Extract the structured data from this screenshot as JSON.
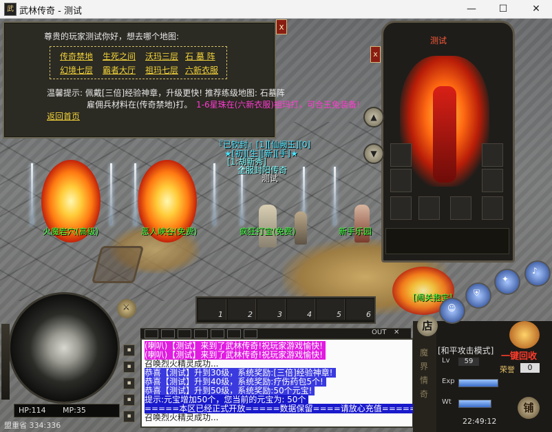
{
  "window": {
    "title": "武林传奇 - 测试",
    "app_icon_text": "武",
    "minimize_glyph": "—",
    "maximize_glyph": "☐",
    "close_glyph": "✕"
  },
  "info_panel": {
    "greeting": "尊贵的玩家测试你好，想去哪个地图:",
    "maps": [
      "传奇禁地",
      "生死之间",
      "沃玛三层",
      "石 墓 阵",
      "幻境七层",
      "霸者大厅",
      "祖玛七层",
      "六新衣服"
    ],
    "tip_line1": "温馨提示: 佩戴[三倍]经验神章，升级更快! 推荐练级地图: 石墓阵",
    "tip_line2": "雇佣兵材料在(传奇禁地)打。",
    "tip_highlight": "1-6星珠在(六新衣服)祖玛打，可合玉兔装备!",
    "back_link": "返回首页",
    "close_glyph": "x"
  },
  "player_overhead": {
    "line1": "『已钦封』[1][仙阙玉][0]",
    "line2": "★[初][生][新][手]★",
    "line3": "[1:胡新秀]",
    "line4": "全服封阳传奇",
    "name": "测试"
  },
  "npcs": [
    {
      "name": "火魔岩穴(高级)",
      "color": "#3dff3d"
    },
    {
      "name": "恶人峡谷(免费)",
      "color": "#3dff3d"
    },
    {
      "name": "疯狂打宝(免费)",
      "color": "#3dff3d"
    },
    {
      "name": "新手乐园",
      "color": "#3dff3d"
    },
    {
      "name": "[闹关抱宝]",
      "color": "#3dff3d"
    }
  ],
  "char_panel": {
    "title": "测试",
    "close_glyph": "x"
  },
  "hotbar": {
    "slots": [
      "1",
      "2",
      "3",
      "4",
      "5",
      "6"
    ]
  },
  "hud": {
    "hp": "HP:114",
    "mp": "MP:35",
    "location": "盟重省 334:336",
    "out_label": "OUT",
    "attack_mode": "[和平攻击模式]",
    "level_value": "59",
    "one_key_recycle": "一键回收",
    "honor_label": "荣誉",
    "honor_value": "0",
    "time": "22:49:12",
    "shop_label": "店",
    "pawn_label": "铺",
    "side_vertical": "魔 界 情 奇"
  },
  "chat": [
    {
      "text": "(喇叭)【测试】来到了武林传奇!祝玩家游戏愉快!",
      "bg": "#e11ce1",
      "fg": "#ffffff"
    },
    {
      "text": "(喇叭)【测试】来到了武林传奇!祝玩家游戏愉快!",
      "bg": "#e11ce1",
      "fg": "#ffffff"
    },
    {
      "text": "召唤烈火精灵成功...",
      "bg": "",
      "fg": "#1a1a1a"
    },
    {
      "text": "恭喜【测试】升到30级，系统奖励:[三倍]经验神章!",
      "bg": "#3a3adf",
      "fg": "#ffffff"
    },
    {
      "text": "恭喜【测试】升到40级，系统奖励:疗伤药包5个!",
      "bg": "#3a3adf",
      "fg": "#ffffff"
    },
    {
      "text": "恭喜【测试】升到50级，系统奖励:50个元宝!",
      "bg": "#3a3adf",
      "fg": "#ffffff"
    },
    {
      "text": "提示:元宝增加50个，您当前的元宝为: 50个",
      "bg": "#1a1acc",
      "fg": "#ffffff"
    },
    {
      "text": "=====本区已经正式开放=====数据保留====请放心充值=====",
      "bg": "#1a1acc",
      "fg": "#ffffff"
    },
    {
      "text": "召唤烈火精灵成功...",
      "bg": "",
      "fg": "#1a1a1a"
    }
  ]
}
